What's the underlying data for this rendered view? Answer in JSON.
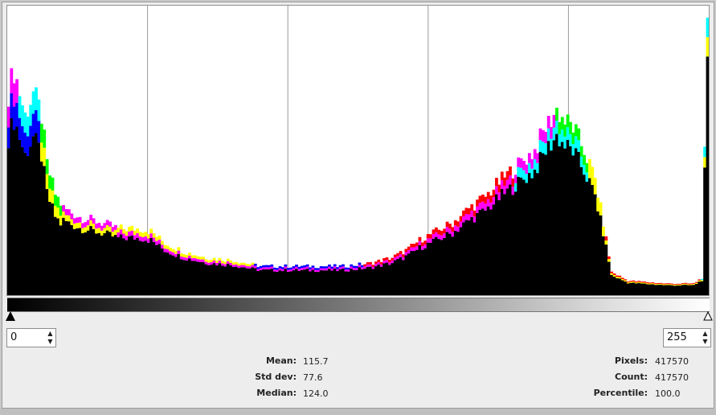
{
  "histogram": {
    "x_max": 255,
    "gridline_values": [
      51,
      102,
      153,
      204
    ],
    "channel_colors": {
      "black": "#000000",
      "red": "#ff0000",
      "green": "#00ff00",
      "blue": "#0000ff",
      "cyan": "#00ffff",
      "magenta": "#ff00ff",
      "yellow": "#ffff00"
    }
  },
  "range": {
    "min_value": "0",
    "max_value": "255"
  },
  "stats_left": [
    {
      "label": "Mean:",
      "value": "115.7"
    },
    {
      "label": "Std dev:",
      "value": "77.6"
    },
    {
      "label": "Median:",
      "value": "124.0"
    }
  ],
  "stats_right": [
    {
      "label": "Pixels:",
      "value": "417570"
    },
    {
      "label": "Count:",
      "value": "417570"
    },
    {
      "label": "Percentile:",
      "value": "100.0"
    }
  ],
  "icons": {
    "spin_up": "▲",
    "spin_down": "▼"
  }
}
